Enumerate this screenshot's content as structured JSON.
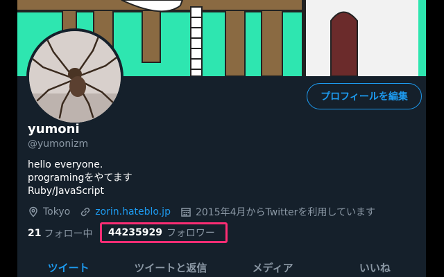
{
  "profile": {
    "edit_button": "プロフィールを編集",
    "name": "yumoni",
    "handle": "@yumonizm",
    "bio": [
      "hello everyone.",
      "programingをやてます",
      "Ruby/JavaScript"
    ],
    "location": "Tokyo",
    "website": "zorin.hateblo.jp",
    "joined": "2015年4月からTwitterを利用しています",
    "following_count": "21",
    "following_label": "フォロー中",
    "followers_count": "44235929",
    "followers_label": "フォロワー"
  },
  "tabs": [
    {
      "label": "ツイート",
      "active": true
    },
    {
      "label": "ツイートと返信",
      "active": false
    },
    {
      "label": "メディア",
      "active": false
    },
    {
      "label": "いいね",
      "active": false
    }
  ],
  "colors": {
    "background": "#15202b",
    "accent": "#1d9bf0",
    "highlight": "#ff2d74",
    "banner": "#2ee6b0"
  },
  "icons": [
    "location-pin-icon",
    "link-icon",
    "calendar-icon"
  ]
}
